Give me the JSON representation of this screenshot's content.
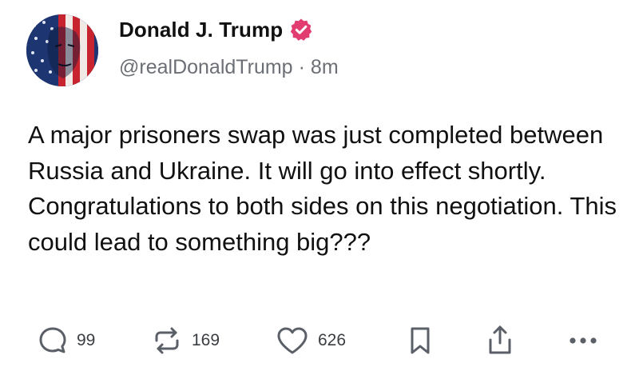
{
  "author": {
    "display_name": "Donald J. Trump",
    "handle": "@realDonaldTrump",
    "separator": "·",
    "time_ago": "8m",
    "verified": true,
    "verified_color": "#e13d71",
    "avatar_icon": "flag-portrait-avatar"
  },
  "post": {
    "text": "A major prisoners swap was just completed between Russia and Ukraine. It will go into effect shortly. Congratulations to both sides on this negotiation. This could lead to something big???"
  },
  "actions": {
    "replies": "99",
    "reposts": "169",
    "likes": "626",
    "icons": [
      "reply-icon",
      "repost-icon",
      "like-icon",
      "bookmark-icon",
      "share-icon",
      "more-icon"
    ],
    "icon_color": "#5b6068"
  }
}
